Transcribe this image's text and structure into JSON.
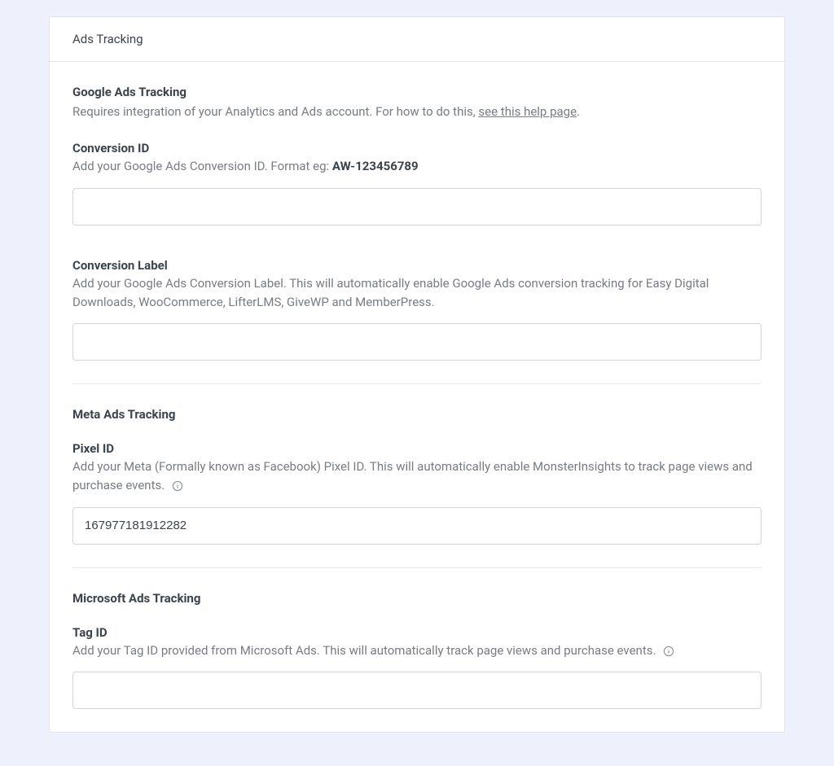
{
  "panel": {
    "title": "Ads Tracking"
  },
  "google": {
    "heading": "Google Ads Tracking",
    "desc_pre": "Requires integration of your Analytics and Ads account. For how to do this, ",
    "desc_link": "see this help page",
    "desc_post": ".",
    "conversion_id": {
      "label": "Conversion ID",
      "desc_pre": "Add your Google Ads Conversion ID. Format eg: ",
      "desc_bold": "AW-123456789",
      "value": ""
    },
    "conversion_label": {
      "label": "Conversion Label",
      "desc": "Add your Google Ads Conversion Label. This will automatically enable Google Ads conversion tracking for Easy Digital Downloads, WooCommerce, LifterLMS, GiveWP and MemberPress.",
      "value": ""
    }
  },
  "meta": {
    "heading": "Meta Ads Tracking",
    "pixel_id": {
      "label": "Pixel ID",
      "desc": "Add your Meta (Formally known as Facebook) Pixel ID. This will automatically enable MonsterInsights to track page views and purchase events.",
      "value": "167977181912282"
    }
  },
  "microsoft": {
    "heading": "Microsoft Ads Tracking",
    "tag_id": {
      "label": "Tag ID",
      "desc": "Add your Tag ID provided from Microsoft Ads. This will automatically track page views and purchase events.",
      "value": ""
    }
  }
}
